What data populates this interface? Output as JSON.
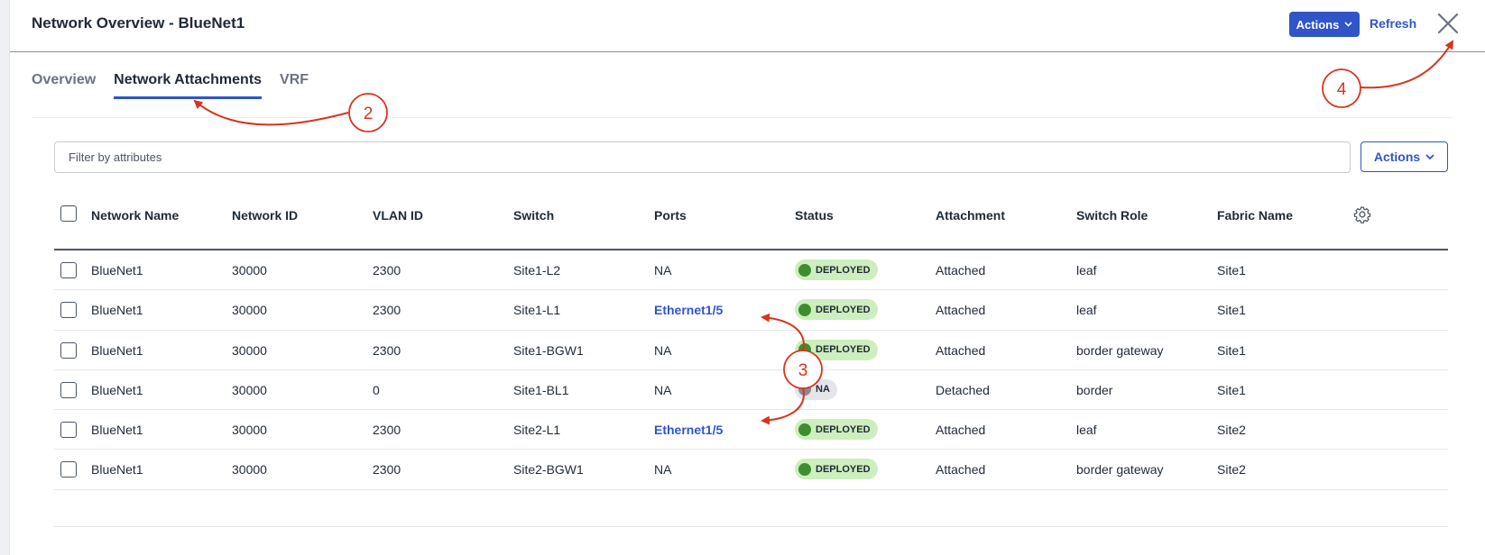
{
  "header": {
    "title": "Network Overview - BlueNet1",
    "actions_label": "Actions",
    "refresh_label": "Refresh"
  },
  "tabs": [
    {
      "label": "Overview",
      "active": false
    },
    {
      "label": "Network Attachments",
      "active": true
    },
    {
      "label": "VRF",
      "active": false
    }
  ],
  "filter": {
    "placeholder": "Filter by attributes",
    "actions_label": "Actions"
  },
  "table": {
    "columns": [
      "Network Name",
      "Network ID",
      "VLAN ID",
      "Switch",
      "Ports",
      "Status",
      "Attachment",
      "Switch Role",
      "Fabric Name"
    ],
    "rows": [
      {
        "network_name": "BlueNet1",
        "network_id": "30000",
        "vlan_id": "2300",
        "switch": "Site1-L2",
        "ports": "NA",
        "ports_link": false,
        "status": "DEPLOYED",
        "attachment": "Attached",
        "switch_role": "leaf",
        "fabric_name": "Site1"
      },
      {
        "network_name": "BlueNet1",
        "network_id": "30000",
        "vlan_id": "2300",
        "switch": "Site1-L1",
        "ports": "Ethernet1/5",
        "ports_link": true,
        "status": "DEPLOYED",
        "attachment": "Attached",
        "switch_role": "leaf",
        "fabric_name": "Site1"
      },
      {
        "network_name": "BlueNet1",
        "network_id": "30000",
        "vlan_id": "2300",
        "switch": "Site1-BGW1",
        "ports": "NA",
        "ports_link": false,
        "status": "DEPLOYED",
        "attachment": "Attached",
        "switch_role": "border gateway",
        "fabric_name": "Site1"
      },
      {
        "network_name": "BlueNet1",
        "network_id": "30000",
        "vlan_id": "0",
        "switch": "Site1-BL1",
        "ports": "NA",
        "ports_link": false,
        "status": "NA",
        "attachment": "Detached",
        "switch_role": "border",
        "fabric_name": "Site1"
      },
      {
        "network_name": "BlueNet1",
        "network_id": "30000",
        "vlan_id": "2300",
        "switch": "Site2-L1",
        "ports": "Ethernet1/5",
        "ports_link": true,
        "status": "DEPLOYED",
        "attachment": "Attached",
        "switch_role": "leaf",
        "fabric_name": "Site2"
      },
      {
        "network_name": "BlueNet1",
        "network_id": "30000",
        "vlan_id": "2300",
        "switch": "Site2-BGW1",
        "ports": "NA",
        "ports_link": false,
        "status": "DEPLOYED",
        "attachment": "Attached",
        "switch_role": "border gateway",
        "fabric_name": "Site2"
      }
    ]
  },
  "annotations": {
    "callout_2": "2",
    "callout_3": "3",
    "callout_4": "4",
    "color": "#d9331a"
  },
  "icons": {
    "close": "close-icon",
    "gear": "gear-icon",
    "chevron": "chevron-down-icon"
  }
}
